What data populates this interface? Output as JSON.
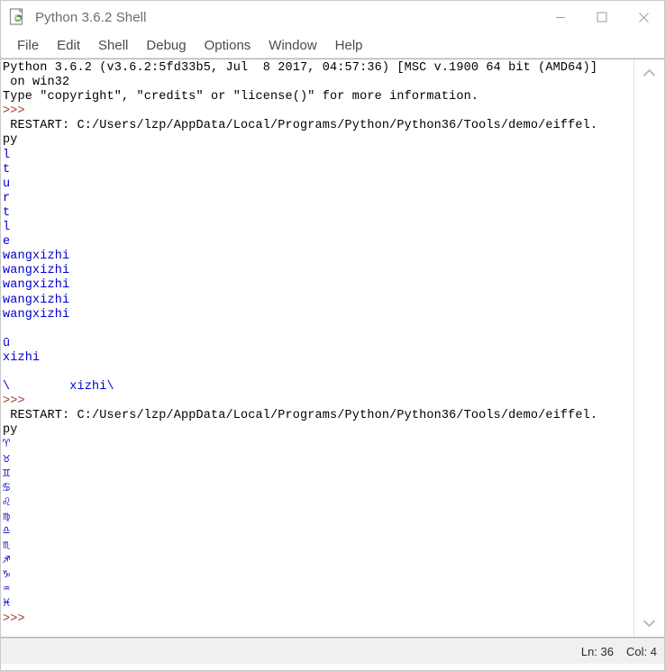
{
  "window": {
    "title": "Python 3.6.2 Shell",
    "icon": "python-idle-icon",
    "controls": {
      "minimize": "minimize-icon",
      "maximize": "maximize-icon",
      "close": "close-icon"
    }
  },
  "menubar": {
    "items": [
      {
        "label": "File"
      },
      {
        "label": "Edit"
      },
      {
        "label": "Shell"
      },
      {
        "label": "Debug"
      },
      {
        "label": "Options"
      },
      {
        "label": "Window"
      },
      {
        "label": "Help"
      }
    ]
  },
  "console": {
    "lines": [
      {
        "text": "Python 3.6.2 (v3.6.2:5fd33b5, Jul  8 2017, 04:57:36) [MSC v.1900 64 bit (AMD64)]",
        "color": "black"
      },
      {
        "text": " on win32",
        "color": "black"
      },
      {
        "text": "Type \"copyright\", \"credits\" or \"license()\" for more information.",
        "color": "black"
      },
      {
        "text": ">>> ",
        "color": "prompt"
      },
      {
        "text": " RESTART: C:/Users/lzp/AppData/Local/Programs/Python/Python36/Tools/demo/eiffel.",
        "color": "black"
      },
      {
        "text": "py",
        "color": "black"
      },
      {
        "text": "l",
        "color": "blue"
      },
      {
        "text": "t",
        "color": "blue"
      },
      {
        "text": "u",
        "color": "blue"
      },
      {
        "text": "r",
        "color": "blue"
      },
      {
        "text": "t",
        "color": "blue"
      },
      {
        "text": "l",
        "color": "blue"
      },
      {
        "text": "e",
        "color": "blue"
      },
      {
        "text": "wangxizhi",
        "color": "blue"
      },
      {
        "text": "wangxizhi",
        "color": "blue"
      },
      {
        "text": "wangxizhi",
        "color": "blue"
      },
      {
        "text": "wangxizhi",
        "color": "blue"
      },
      {
        "text": "wangxizhi",
        "color": "blue"
      },
      {
        "text": "",
        "color": "black"
      },
      {
        "text": "ū",
        "color": "blue"
      },
      {
        "text": "xizhi",
        "color": "blue"
      },
      {
        "text": "",
        "color": "black"
      },
      {
        "text": "\\        xizhi\\",
        "color": "blue"
      },
      {
        "text": ">>> ",
        "color": "prompt"
      },
      {
        "text": " RESTART: C:/Users/lzp/AppData/Local/Programs/Python/Python36/Tools/demo/eiffel.",
        "color": "black"
      },
      {
        "text": "py",
        "color": "black"
      },
      {
        "text": "♈",
        "color": "blue"
      },
      {
        "text": "♉",
        "color": "blue"
      },
      {
        "text": "♊",
        "color": "blue"
      },
      {
        "text": "♋",
        "color": "blue"
      },
      {
        "text": "♌",
        "color": "blue"
      },
      {
        "text": "♍",
        "color": "blue"
      },
      {
        "text": "♎",
        "color": "blue"
      },
      {
        "text": "♏",
        "color": "blue"
      },
      {
        "text": "♐",
        "color": "blue"
      },
      {
        "text": "♑",
        "color": "blue"
      },
      {
        "text": "♒",
        "color": "blue"
      },
      {
        "text": "♓",
        "color": "blue"
      },
      {
        "text": ">>> ",
        "color": "prompt"
      }
    ]
  },
  "scrollbar": {
    "up_arrow": "chevron-up-icon",
    "down_arrow": "chevron-down-icon"
  },
  "statusbar": {
    "line_label": "Ln: 36",
    "col_label": "Col: 4"
  },
  "colors": {
    "output_blue": "#0000cc",
    "prompt_brown": "#a03a28",
    "text_black": "#000000",
    "titlebar_bg": "#ffffff",
    "statusbar_bg": "#f0f0f0"
  }
}
